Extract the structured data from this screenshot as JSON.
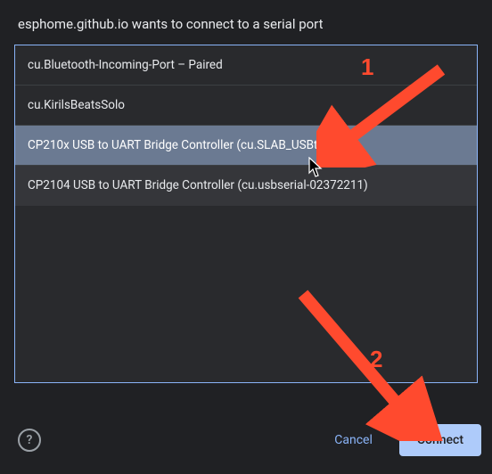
{
  "dialog": {
    "title": "esphome.github.io wants to connect to a serial port"
  },
  "ports": [
    {
      "label": "cu.Bluetooth-Incoming-Port – Paired",
      "selected": false
    },
    {
      "label": "cu.KirilsBeatsSolo",
      "selected": false
    },
    {
      "label": "CP210x USB to UART Bridge Controller (cu.SLAB_USBtoUART)",
      "selected": true
    },
    {
      "label": "CP2104 USB to UART Bridge Controller (cu.usbserial-02372211)",
      "selected": false
    }
  ],
  "buttons": {
    "cancel": "Cancel",
    "connect": "Connect"
  },
  "help": {
    "glyph": "?"
  },
  "annotations": {
    "step1": "1",
    "step2": "2",
    "color": "#ff4a2e"
  }
}
